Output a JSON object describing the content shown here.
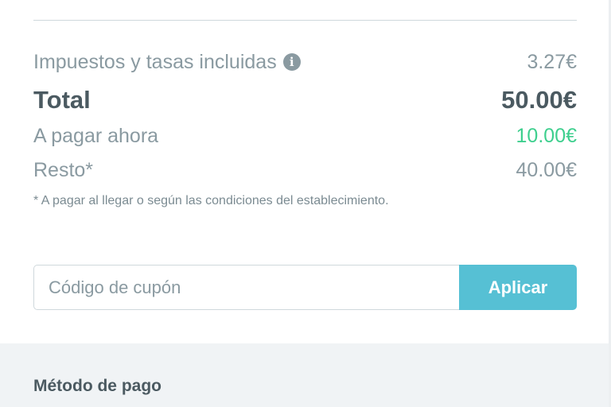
{
  "summary": {
    "taxes": {
      "label": "Impuestos y tasas incluidas",
      "value": "3.27€",
      "icon": "info-icon"
    },
    "total": {
      "label": "Total",
      "value": "50.00€"
    },
    "pay_now": {
      "label": "A pagar ahora",
      "value": "10.00€",
      "color": "#3ecf8e"
    },
    "rest": {
      "label": "Resto*",
      "value": "40.00€"
    },
    "note": "* A pagar al llegar o según las condiciones del establecimiento."
  },
  "coupon": {
    "placeholder": "Código de cupón",
    "value": "",
    "button_label": "Aplicar",
    "button_color": "#56c0d4"
  },
  "payment": {
    "title": "Método de pago"
  }
}
